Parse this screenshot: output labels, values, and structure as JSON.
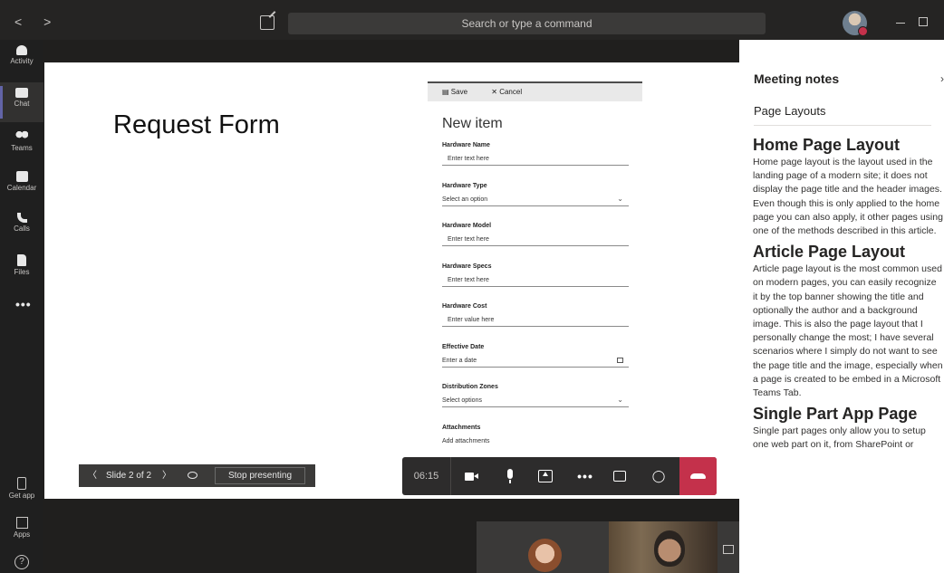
{
  "titlebar": {
    "search_placeholder": "Search or type a command",
    "nav_arrows": "<  >"
  },
  "rail": {
    "items": [
      {
        "label": "Activity",
        "icon": "bell-icon"
      },
      {
        "label": "Chat",
        "icon": "chat-icon"
      },
      {
        "label": "Teams",
        "icon": "teams-icon"
      },
      {
        "label": "Calendar",
        "icon": "calendar-icon"
      },
      {
        "label": "Calls",
        "icon": "phone-icon"
      },
      {
        "label": "Files",
        "icon": "file-icon"
      }
    ],
    "more_label": "•••",
    "bottom": [
      {
        "label": "Get app",
        "icon": "device-icon"
      },
      {
        "label": "Apps",
        "icon": "apps-icon"
      }
    ],
    "help_glyph": "?"
  },
  "slide": {
    "title": "Request Form"
  },
  "form": {
    "save_label": "Save",
    "cancel_label": "Cancel",
    "title": "New item",
    "fields": [
      {
        "label": "Hardware Name",
        "value": "Enter text here"
      },
      {
        "label": "Hardware Type",
        "value": "Select an option"
      },
      {
        "label": "Hardware Model",
        "value": "Enter text here"
      },
      {
        "label": "Hardware Specs",
        "value": "Enter text here"
      },
      {
        "label": "Hardware Cost",
        "value": "Enter value here"
      },
      {
        "label": "Effective Date",
        "value": "Enter a date"
      },
      {
        "label": "Distribution Zones",
        "value": "Select options"
      },
      {
        "label": "Attachments",
        "value": "Add attachments"
      }
    ]
  },
  "presenter_bar": {
    "slide_counter": "Slide 2 of 2",
    "stop_label": "Stop presenting"
  },
  "call": {
    "timer": "06:15"
  },
  "notes": {
    "heading": "Meeting notes",
    "page": "Page Layouts",
    "sections": [
      {
        "title": "Home Page Layout",
        "body": "Home page layout is the layout used in the landing page of a modern site; it does not display the page title and the header images. Even though this is only applied to the home page you can also apply, it other pages using one of the methods described in this article."
      },
      {
        "title": "Article Page Layout",
        "body": "Article page layout is the most common used on modern pages, you can easily recognize it by the top banner showing the title and optionally the author and a background image. This is also the page layout that I personally change the most; I have several scenarios where I simply do not want to see the page title and the image, especially when a page is created to be embed in a Microsoft Teams Tab."
      },
      {
        "title": "Single Part App Page",
        "body": "Single part pages only allow you to setup one web part on it, from SharePoint or"
      }
    ]
  },
  "colors": {
    "accent": "#6264a7",
    "hangup": "#c4314b",
    "rail_bg": "#1f1f1f",
    "titlebar_bg": "#252423"
  }
}
